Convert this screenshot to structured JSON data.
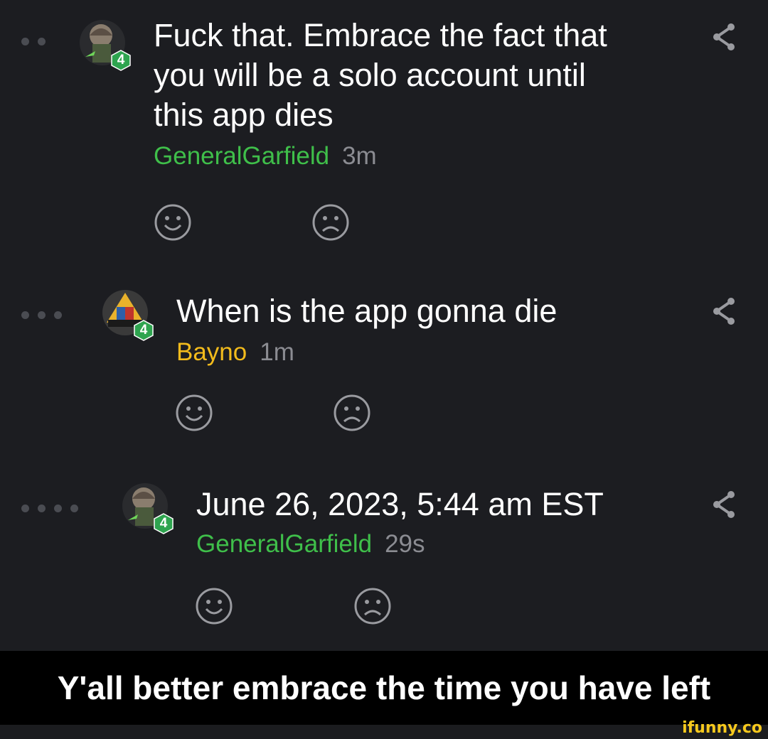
{
  "colors": {
    "background": "#1c1d21",
    "username_green": "#3fbf4a",
    "username_yellow": "#f2bb1c",
    "level_badge": "#2ea44f",
    "icon_gray": "#9a9ba0"
  },
  "comments": [
    {
      "text_lines": [
        "Fuck that. Embrace the fact that",
        "you will be a solo account until",
        "this app dies"
      ],
      "username": "GeneralGarfield",
      "time": "3m",
      "level": "4",
      "depth": 2
    },
    {
      "text_lines": [
        "When is the app gonna die"
      ],
      "username": "Bayno",
      "time": "1m",
      "level": "4",
      "depth": 3
    },
    {
      "text_lines": [
        "June 26, 2023, 5:44 am EST"
      ],
      "username": "GeneralGarfield",
      "time": "29s",
      "level": "4",
      "depth": 4
    }
  ],
  "caption": "Y'all better embrace the time you have left",
  "watermark": "ifunny.co"
}
